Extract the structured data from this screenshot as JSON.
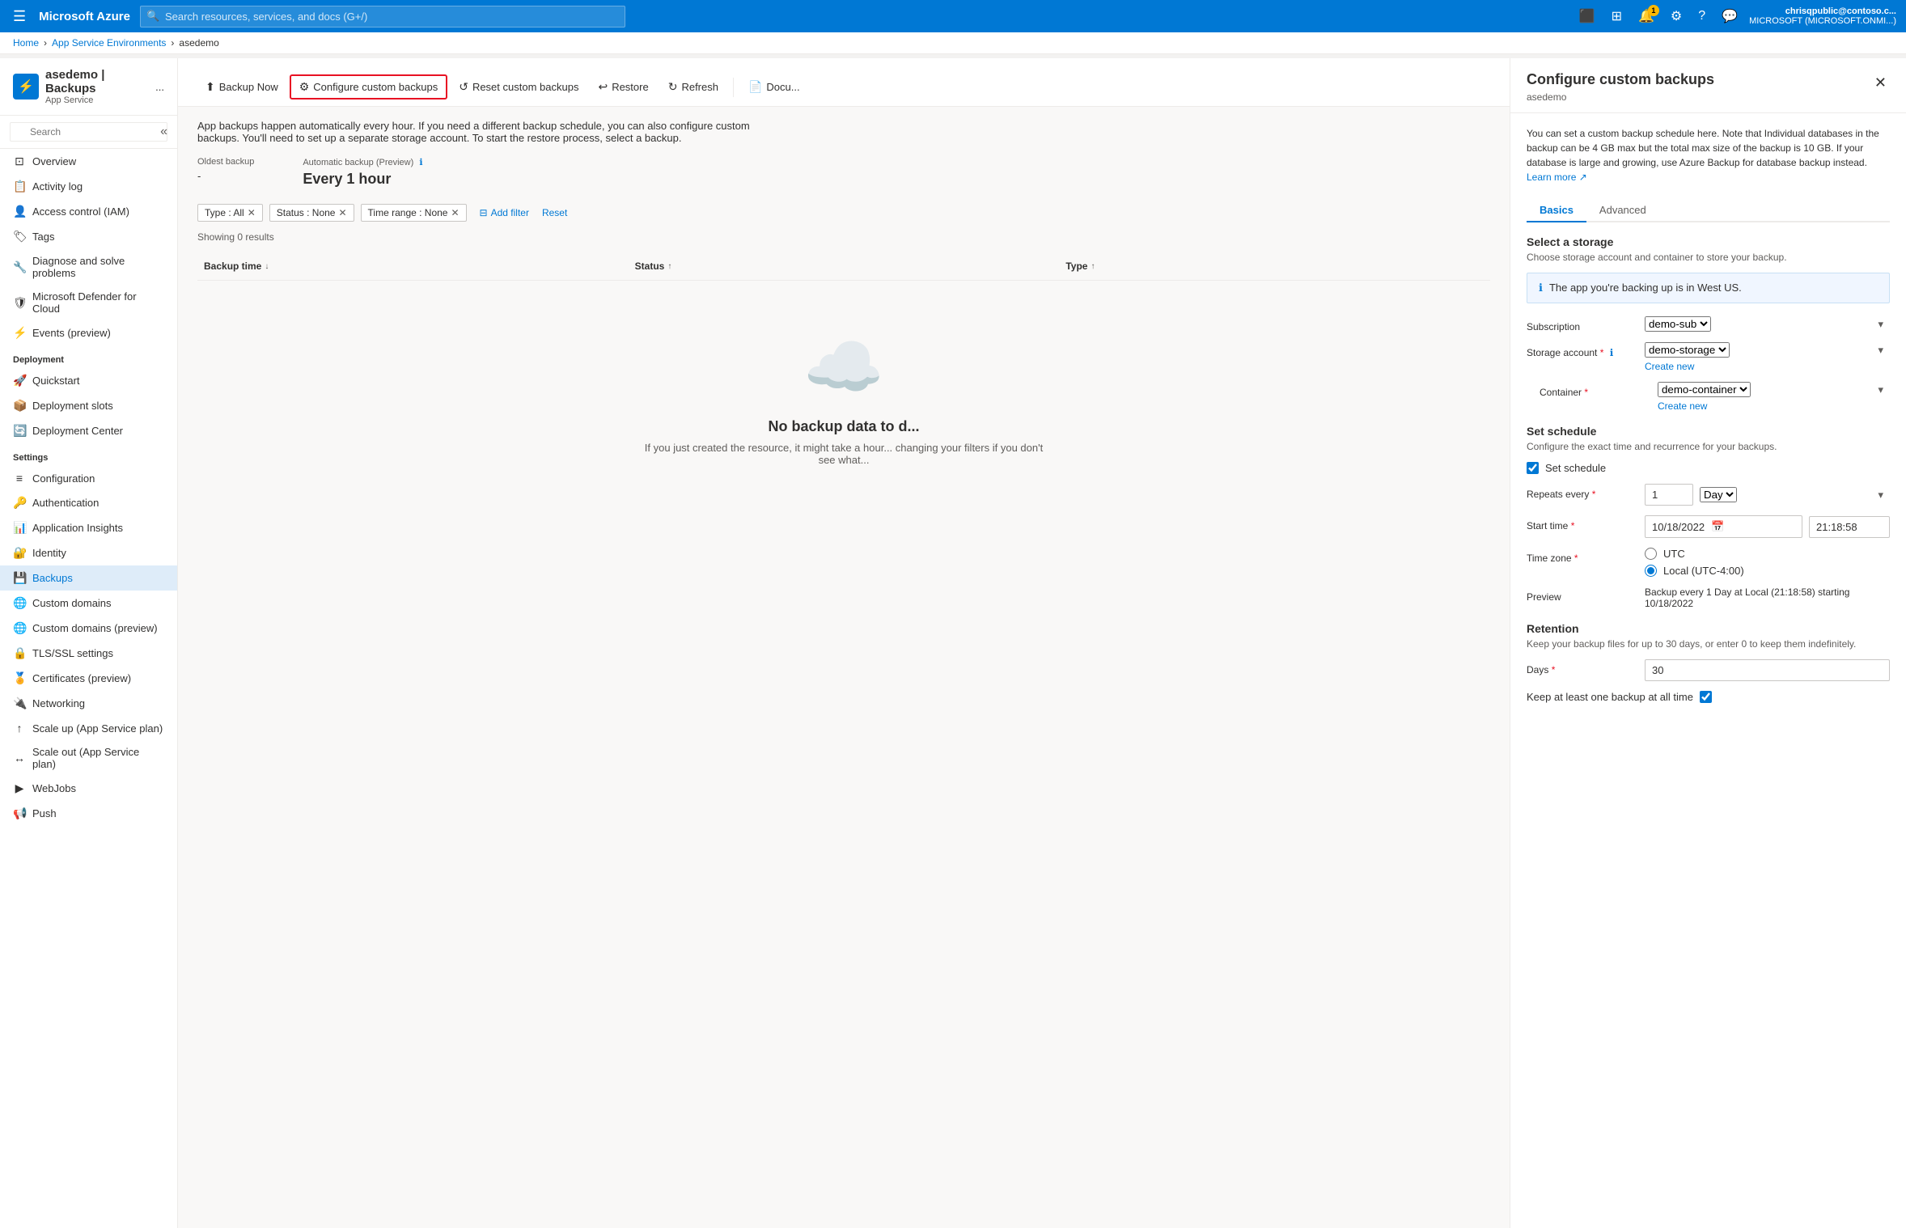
{
  "topnav": {
    "hamburger": "☰",
    "logo": "Microsoft Azure",
    "search_placeholder": "Search resources, services, and docs (G+/)",
    "user_name": "chrisqpublic@contoso.c...",
    "user_tenant": "MICROSOFT (MICROSOFT.ONMI...)",
    "notification_count": "1"
  },
  "breadcrumb": {
    "home": "Home",
    "env": "App Service Environments",
    "current": "asedemo"
  },
  "resource": {
    "name": "asedemo | Backups",
    "type": "App Service",
    "more": "..."
  },
  "sidebar_search": {
    "placeholder": "Search"
  },
  "nav_items": {
    "overview": "Overview",
    "activity_log": "Activity log",
    "access_control": "Access control (IAM)",
    "tags": "Tags",
    "diagnose": "Diagnose and solve problems",
    "defender": "Microsoft Defender for Cloud",
    "events": "Events (preview)",
    "deployment_header": "Deployment",
    "quickstart": "Quickstart",
    "deployment_slots": "Deployment slots",
    "deployment_center": "Deployment Center",
    "settings_header": "Settings",
    "configuration": "Configuration",
    "authentication": "Authentication",
    "app_insights": "Application Insights",
    "identity": "Identity",
    "backups": "Backups",
    "custom_domains": "Custom domains",
    "custom_domains_preview": "Custom domains (preview)",
    "tls_ssl": "TLS/SSL settings",
    "certificates": "Certificates (preview)",
    "networking": "Networking",
    "scale_up": "Scale up (App Service plan)",
    "scale_out": "Scale out (App Service plan)",
    "webjobs": "WebJobs",
    "push": "Push"
  },
  "toolbar": {
    "backup_now": "Backup Now",
    "configure_backups": "Configure custom backups",
    "reset_backups": "Reset custom backups",
    "restore": "Restore",
    "refresh": "Refresh",
    "docs": "Docu..."
  },
  "backup_page": {
    "description": "App backups happen automatically every hour. If you need a different backup schedule, you can also configure custom backups. You'll need to set up a separate storage account. To start the restore process, select a backup.",
    "oldest_label": "Oldest backup",
    "oldest_value": "-",
    "auto_backup_label": "Automatic backup (Preview)",
    "auto_backup_value": "Every 1 hour",
    "showing_count": "Showing 0 results",
    "filter_type": "Type : All",
    "filter_status": "Status : None",
    "filter_time": "Time range : None",
    "add_filter": "Add filter",
    "reset": "Reset",
    "col_backup_time": "Backup time",
    "col_status": "Status",
    "col_type": "Type",
    "empty_title": "No backup data to d...",
    "empty_desc": "If you just created the resource, it might take a hour... changing your filters if you don't see what..."
  },
  "right_panel": {
    "title": "Configure custom backups",
    "subtitle": "asedemo",
    "desc": "You can set a custom backup schedule here. Note that Individual databases in the backup can be 4 GB max but the total max size of the backup is 10 GB. If your database is large and growing, use Azure Backup for database backup instead.",
    "learn_more": "Learn more",
    "info_text": "The app you're backing up is in West US.",
    "tab_basics": "Basics",
    "tab_advanced": "Advanced",
    "storage_title": "Select a storage",
    "storage_desc": "Choose storage account and container to store your backup.",
    "subscription_label": "Subscription",
    "subscription_value": "demo-sub",
    "storage_account_label": "Storage account",
    "storage_account_required": "*",
    "storage_account_value": "demo-storage",
    "storage_account_create": "Create new",
    "container_label": "Container",
    "container_required": "*",
    "container_value": "demo-container",
    "container_create": "Create new",
    "schedule_title": "Set schedule",
    "schedule_desc": "Configure the exact time and recurrence for your backups.",
    "set_schedule_label": "Set schedule",
    "repeats_label": "Repeats every",
    "repeats_required": "*",
    "repeats_value": "1",
    "repeats_unit": "Day",
    "start_time_label": "Start time",
    "start_time_required": "*",
    "start_date": "10/18/2022",
    "start_time_value": "21:18:58",
    "timezone_label": "Time zone",
    "timezone_required": "*",
    "tz_utc": "UTC",
    "tz_local": "Local (UTC-4:00)",
    "preview_label": "Preview",
    "preview_value": "Backup every 1 Day at Local (21:18:58) starting 10/18/2022",
    "retention_title": "Retention",
    "retention_desc": "Keep your backup files for up to 30 days, or enter 0 to keep them indefinitely.",
    "days_label": "Days",
    "days_required": "*",
    "days_value": "30",
    "keep_label": "Keep at least one backup at all time"
  }
}
